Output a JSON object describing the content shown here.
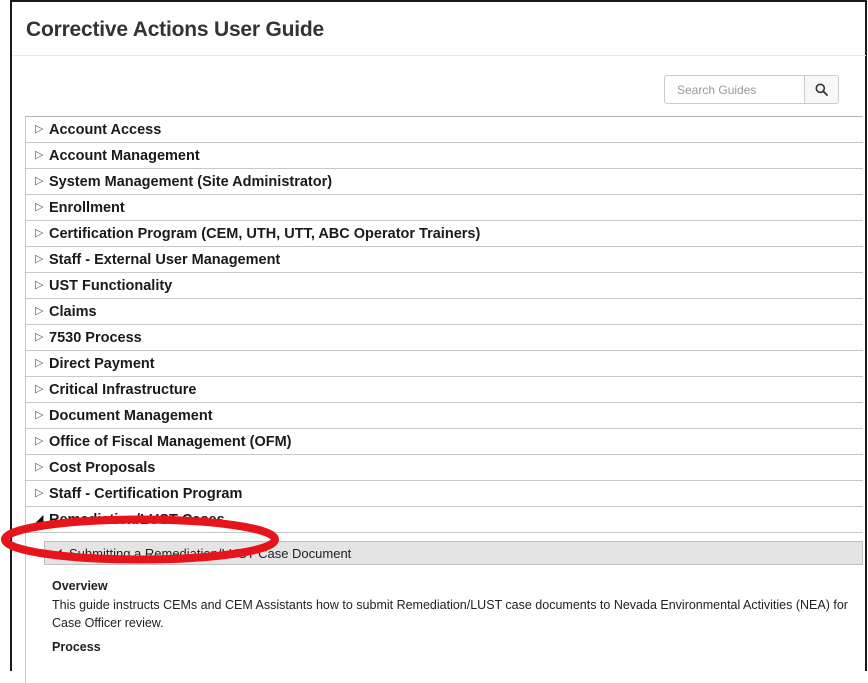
{
  "page": {
    "title": "Corrective Actions User Guide"
  },
  "search": {
    "placeholder": "Search Guides",
    "icon": "search-icon"
  },
  "accordion": {
    "items": [
      {
        "label": "Account Access",
        "expanded": false
      },
      {
        "label": "Account Management",
        "expanded": false
      },
      {
        "label": "System Management (Site Administrator)",
        "expanded": false
      },
      {
        "label": "Enrollment",
        "expanded": false
      },
      {
        "label": "Certification Program (CEM, UTH, UTT, ABC Operator Trainers)",
        "expanded": false
      },
      {
        "label": "Staff - External User Management",
        "expanded": false
      },
      {
        "label": "UST Functionality",
        "expanded": false
      },
      {
        "label": "Claims",
        "expanded": false
      },
      {
        "label": "7530 Process",
        "expanded": false
      },
      {
        "label": "Direct Payment",
        "expanded": false
      },
      {
        "label": "Critical Infrastructure",
        "expanded": false
      },
      {
        "label": "Document Management",
        "expanded": false
      },
      {
        "label": "Office of Fiscal Management (OFM)",
        "expanded": false
      },
      {
        "label": "Cost Proposals",
        "expanded": false
      },
      {
        "label": "Staff - Certification Program",
        "expanded": false
      },
      {
        "label": "Remediation/LUST Cases",
        "expanded": true
      }
    ],
    "collapsed_marker": "▷",
    "expanded_marker": "◢"
  },
  "sub_section": {
    "title": "Submitting a Remediation/LUST Case Document",
    "overview_label": "Overview",
    "overview_text": "This guide instructs CEMs and CEM Assistants how to submit Remediation/LUST case documents to Nevada Environmental Activities (NEA) for Case Officer review.",
    "process_label": "Process"
  },
  "annotation": {
    "color": "#e8141c"
  }
}
